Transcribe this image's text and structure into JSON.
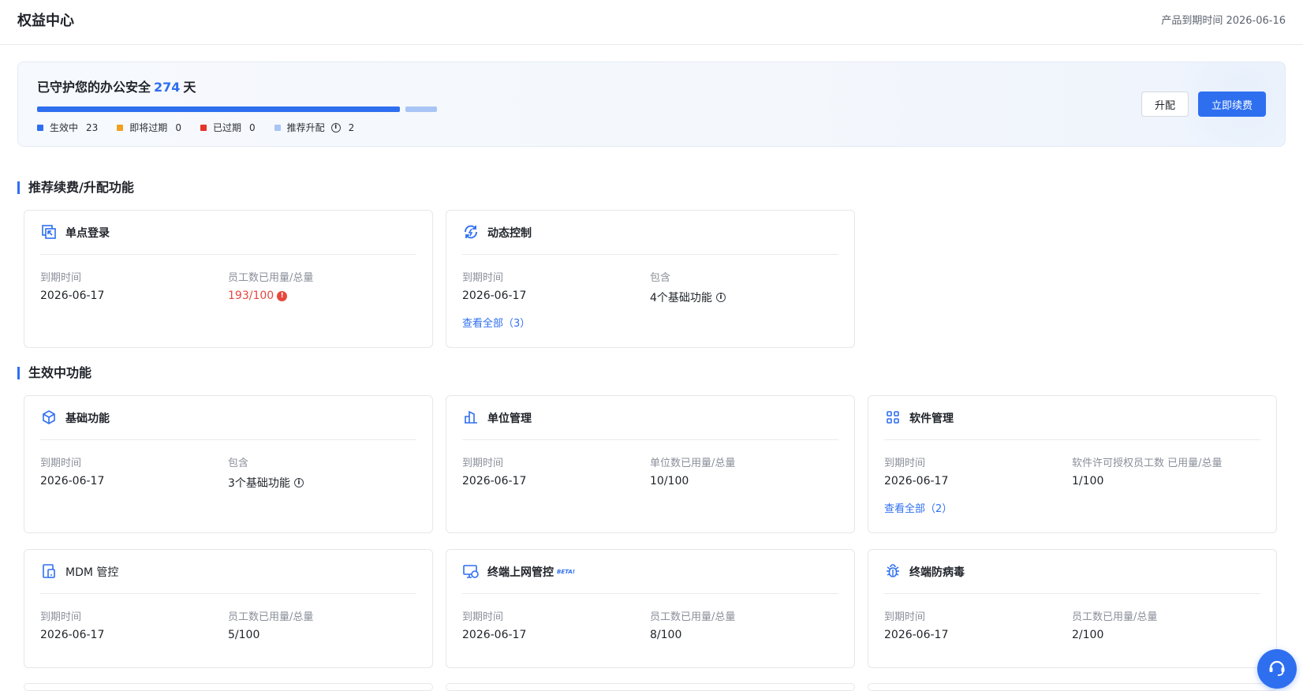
{
  "header": {
    "title": "权益中心",
    "expiry": "产品到期时间 2026-06-16"
  },
  "banner": {
    "protect_prefix": "已守护您的办公安全",
    "protect_days": "274",
    "protect_suffix": "天",
    "legend": [
      {
        "label": "生效中",
        "count": "23",
        "color": "#2e6ff0"
      },
      {
        "label": "即将过期",
        "count": "0",
        "color": "#f0a020"
      },
      {
        "label": "已过期",
        "count": "0",
        "color": "#e5342a"
      },
      {
        "label": "推荐升配",
        "count": "2",
        "color": "#a9c5f5"
      }
    ],
    "upgrade_label": "升配",
    "renew_label": "立即续费"
  },
  "sections": {
    "recommend_title": "推荐续费/升配功能",
    "active_title": "生效中功能"
  },
  "cards": {
    "sso": {
      "title": "单点登录",
      "label1": "到期时间",
      "value1": "2026-06-17",
      "label2": "员工数已用量/总量",
      "value2": "193/100"
    },
    "dynamic": {
      "title": "动态控制",
      "label1": "到期时间",
      "value1": "2026-06-17",
      "label2": "包含",
      "value2": "4个基础功能",
      "view_all": "查看全部（3）"
    },
    "basic": {
      "title": "基础功能",
      "label1": "到期时间",
      "value1": "2026-06-17",
      "label2": "包含",
      "value2": "3个基础功能"
    },
    "unit": {
      "title": "单位管理",
      "label1": "到期时间",
      "value1": "2026-06-17",
      "label2": "单位数已用量/总量",
      "value2": "10/100"
    },
    "software": {
      "title": "软件管理",
      "label1": "到期时间",
      "value1": "2026-06-17",
      "label2": "软件许可授权员工数 已用量/总量",
      "value2": "1/100",
      "view_all": "查看全部（2）"
    },
    "mdm": {
      "title": "MDM 管控",
      "label1": "到期时间",
      "value1": "2026-06-17",
      "label2": "员工数已用量/总量",
      "value2": "5/100"
    },
    "network": {
      "title": "终端上网管控",
      "beta": "BETA!",
      "label1": "到期时间",
      "value1": "2026-06-17",
      "label2": "员工数已用量/总量",
      "value2": "8/100"
    },
    "antivirus": {
      "title": "终端防病毒",
      "label1": "到期时间",
      "value1": "2026-06-17",
      "label2": "员工数已用量/总量",
      "value2": "2/100"
    }
  },
  "icons": {
    "sso": "sso-icon",
    "dynamic": "dynamic-control-icon",
    "basic": "cube-icon",
    "unit": "building-icon",
    "software": "apps-grid-icon",
    "mdm": "mobile-device-icon",
    "network": "monitor-network-icon",
    "antivirus": "bug-icon",
    "support": "headset-icon"
  },
  "colors": {
    "accent": "#2e6ff0",
    "warning": "#e5483e"
  }
}
